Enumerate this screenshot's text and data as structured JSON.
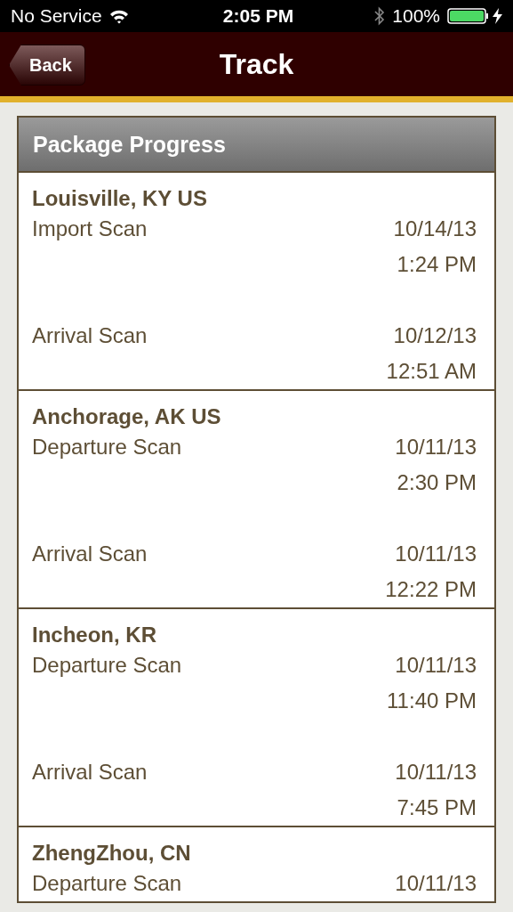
{
  "status_bar": {
    "carrier": "No Service",
    "time": "2:05 PM",
    "battery": "100%"
  },
  "nav": {
    "back": "Back",
    "title": "Track"
  },
  "panel": {
    "title": "Package Progress"
  },
  "locations": [
    {
      "place": "Louisville, KY US",
      "events": [
        {
          "label": "Import Scan",
          "date": "10/14/13",
          "time": "1:24 PM"
        },
        {
          "label": "Arrival Scan",
          "date": "10/12/13",
          "time": "12:51 AM"
        }
      ]
    },
    {
      "place": "Anchorage, AK US",
      "events": [
        {
          "label": "Departure Scan",
          "date": "10/11/13",
          "time": "2:30 PM"
        },
        {
          "label": "Arrival Scan",
          "date": "10/11/13",
          "time": "12:22 PM"
        }
      ]
    },
    {
      "place": "Incheon, KR",
      "events": [
        {
          "label": "Departure Scan",
          "date": "10/11/13",
          "time": "11:40 PM"
        },
        {
          "label": "Arrival Scan",
          "date": "10/11/13",
          "time": "7:45 PM"
        }
      ]
    },
    {
      "place": "ZhengZhou, CN",
      "events": [
        {
          "label": "Departure Scan",
          "date": "10/11/13"
        }
      ]
    }
  ]
}
